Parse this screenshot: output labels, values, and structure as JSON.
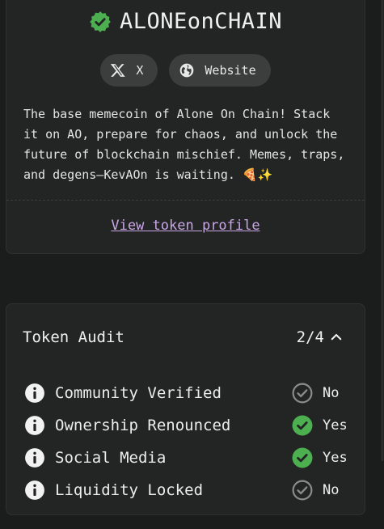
{
  "token": {
    "name": "ALONEonCHAIN",
    "verified_icon": "verified-badge-icon",
    "links": [
      {
        "label": "X",
        "icon": "x-logo-icon"
      },
      {
        "label": "Website",
        "icon": "globe-icon"
      }
    ],
    "description": "The base memecoin of Alone On Chain! Stack it on AO, prepare for chaos, and unlock the future of blockchain mischief. Memes, traps, and degens—KevAOn is waiting. 🍕✨",
    "profile_link": "View token profile"
  },
  "audit": {
    "title": "Token Audit",
    "score": "2/4",
    "items": [
      {
        "label": "Community Verified",
        "status": "No",
        "passed": false
      },
      {
        "label": "Ownership Renounced",
        "status": "Yes",
        "passed": true
      },
      {
        "label": "Social Media",
        "status": "Yes",
        "passed": true
      },
      {
        "label": "Liquidity Locked",
        "status": "No",
        "passed": false
      }
    ]
  },
  "colors": {
    "background": "#1b1c1c",
    "card": "#232424",
    "verified_green": "#4caf50",
    "link_purple": "#c9a6e6",
    "muted_gray": "#8a8c8c"
  }
}
